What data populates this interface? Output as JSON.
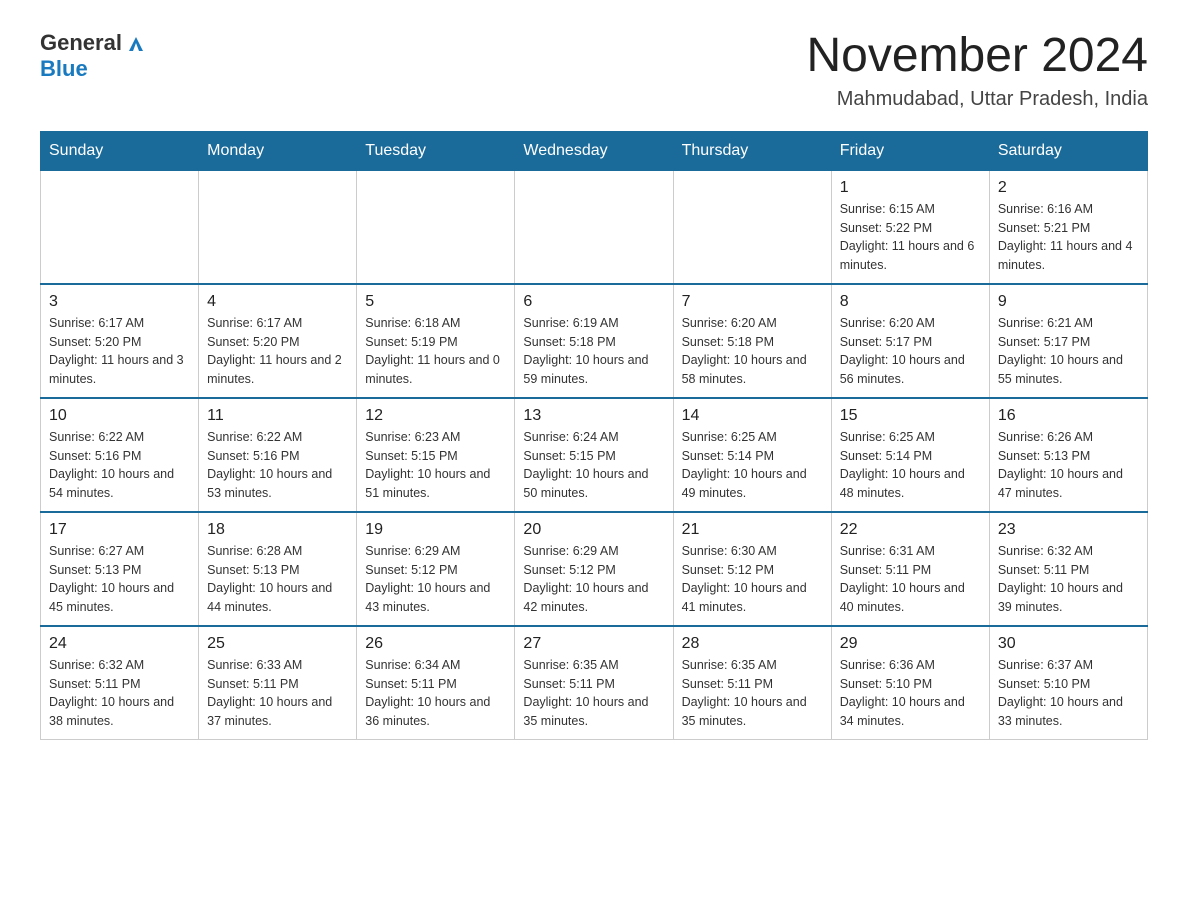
{
  "header": {
    "logo_general": "General",
    "logo_blue": "Blue",
    "month_title": "November 2024",
    "location": "Mahmudabad, Uttar Pradesh, India"
  },
  "days_of_week": [
    "Sunday",
    "Monday",
    "Tuesday",
    "Wednesday",
    "Thursday",
    "Friday",
    "Saturday"
  ],
  "weeks": [
    [
      {
        "day": "",
        "info": ""
      },
      {
        "day": "",
        "info": ""
      },
      {
        "day": "",
        "info": ""
      },
      {
        "day": "",
        "info": ""
      },
      {
        "day": "",
        "info": ""
      },
      {
        "day": "1",
        "info": "Sunrise: 6:15 AM\nSunset: 5:22 PM\nDaylight: 11 hours and 6 minutes."
      },
      {
        "day": "2",
        "info": "Sunrise: 6:16 AM\nSunset: 5:21 PM\nDaylight: 11 hours and 4 minutes."
      }
    ],
    [
      {
        "day": "3",
        "info": "Sunrise: 6:17 AM\nSunset: 5:20 PM\nDaylight: 11 hours and 3 minutes."
      },
      {
        "day": "4",
        "info": "Sunrise: 6:17 AM\nSunset: 5:20 PM\nDaylight: 11 hours and 2 minutes."
      },
      {
        "day": "5",
        "info": "Sunrise: 6:18 AM\nSunset: 5:19 PM\nDaylight: 11 hours and 0 minutes."
      },
      {
        "day": "6",
        "info": "Sunrise: 6:19 AM\nSunset: 5:18 PM\nDaylight: 10 hours and 59 minutes."
      },
      {
        "day": "7",
        "info": "Sunrise: 6:20 AM\nSunset: 5:18 PM\nDaylight: 10 hours and 58 minutes."
      },
      {
        "day": "8",
        "info": "Sunrise: 6:20 AM\nSunset: 5:17 PM\nDaylight: 10 hours and 56 minutes."
      },
      {
        "day": "9",
        "info": "Sunrise: 6:21 AM\nSunset: 5:17 PM\nDaylight: 10 hours and 55 minutes."
      }
    ],
    [
      {
        "day": "10",
        "info": "Sunrise: 6:22 AM\nSunset: 5:16 PM\nDaylight: 10 hours and 54 minutes."
      },
      {
        "day": "11",
        "info": "Sunrise: 6:22 AM\nSunset: 5:16 PM\nDaylight: 10 hours and 53 minutes."
      },
      {
        "day": "12",
        "info": "Sunrise: 6:23 AM\nSunset: 5:15 PM\nDaylight: 10 hours and 51 minutes."
      },
      {
        "day": "13",
        "info": "Sunrise: 6:24 AM\nSunset: 5:15 PM\nDaylight: 10 hours and 50 minutes."
      },
      {
        "day": "14",
        "info": "Sunrise: 6:25 AM\nSunset: 5:14 PM\nDaylight: 10 hours and 49 minutes."
      },
      {
        "day": "15",
        "info": "Sunrise: 6:25 AM\nSunset: 5:14 PM\nDaylight: 10 hours and 48 minutes."
      },
      {
        "day": "16",
        "info": "Sunrise: 6:26 AM\nSunset: 5:13 PM\nDaylight: 10 hours and 47 minutes."
      }
    ],
    [
      {
        "day": "17",
        "info": "Sunrise: 6:27 AM\nSunset: 5:13 PM\nDaylight: 10 hours and 45 minutes."
      },
      {
        "day": "18",
        "info": "Sunrise: 6:28 AM\nSunset: 5:13 PM\nDaylight: 10 hours and 44 minutes."
      },
      {
        "day": "19",
        "info": "Sunrise: 6:29 AM\nSunset: 5:12 PM\nDaylight: 10 hours and 43 minutes."
      },
      {
        "day": "20",
        "info": "Sunrise: 6:29 AM\nSunset: 5:12 PM\nDaylight: 10 hours and 42 minutes."
      },
      {
        "day": "21",
        "info": "Sunrise: 6:30 AM\nSunset: 5:12 PM\nDaylight: 10 hours and 41 minutes."
      },
      {
        "day": "22",
        "info": "Sunrise: 6:31 AM\nSunset: 5:11 PM\nDaylight: 10 hours and 40 minutes."
      },
      {
        "day": "23",
        "info": "Sunrise: 6:32 AM\nSunset: 5:11 PM\nDaylight: 10 hours and 39 minutes."
      }
    ],
    [
      {
        "day": "24",
        "info": "Sunrise: 6:32 AM\nSunset: 5:11 PM\nDaylight: 10 hours and 38 minutes."
      },
      {
        "day": "25",
        "info": "Sunrise: 6:33 AM\nSunset: 5:11 PM\nDaylight: 10 hours and 37 minutes."
      },
      {
        "day": "26",
        "info": "Sunrise: 6:34 AM\nSunset: 5:11 PM\nDaylight: 10 hours and 36 minutes."
      },
      {
        "day": "27",
        "info": "Sunrise: 6:35 AM\nSunset: 5:11 PM\nDaylight: 10 hours and 35 minutes."
      },
      {
        "day": "28",
        "info": "Sunrise: 6:35 AM\nSunset: 5:11 PM\nDaylight: 10 hours and 35 minutes."
      },
      {
        "day": "29",
        "info": "Sunrise: 6:36 AM\nSunset: 5:10 PM\nDaylight: 10 hours and 34 minutes."
      },
      {
        "day": "30",
        "info": "Sunrise: 6:37 AM\nSunset: 5:10 PM\nDaylight: 10 hours and 33 minutes."
      }
    ]
  ]
}
